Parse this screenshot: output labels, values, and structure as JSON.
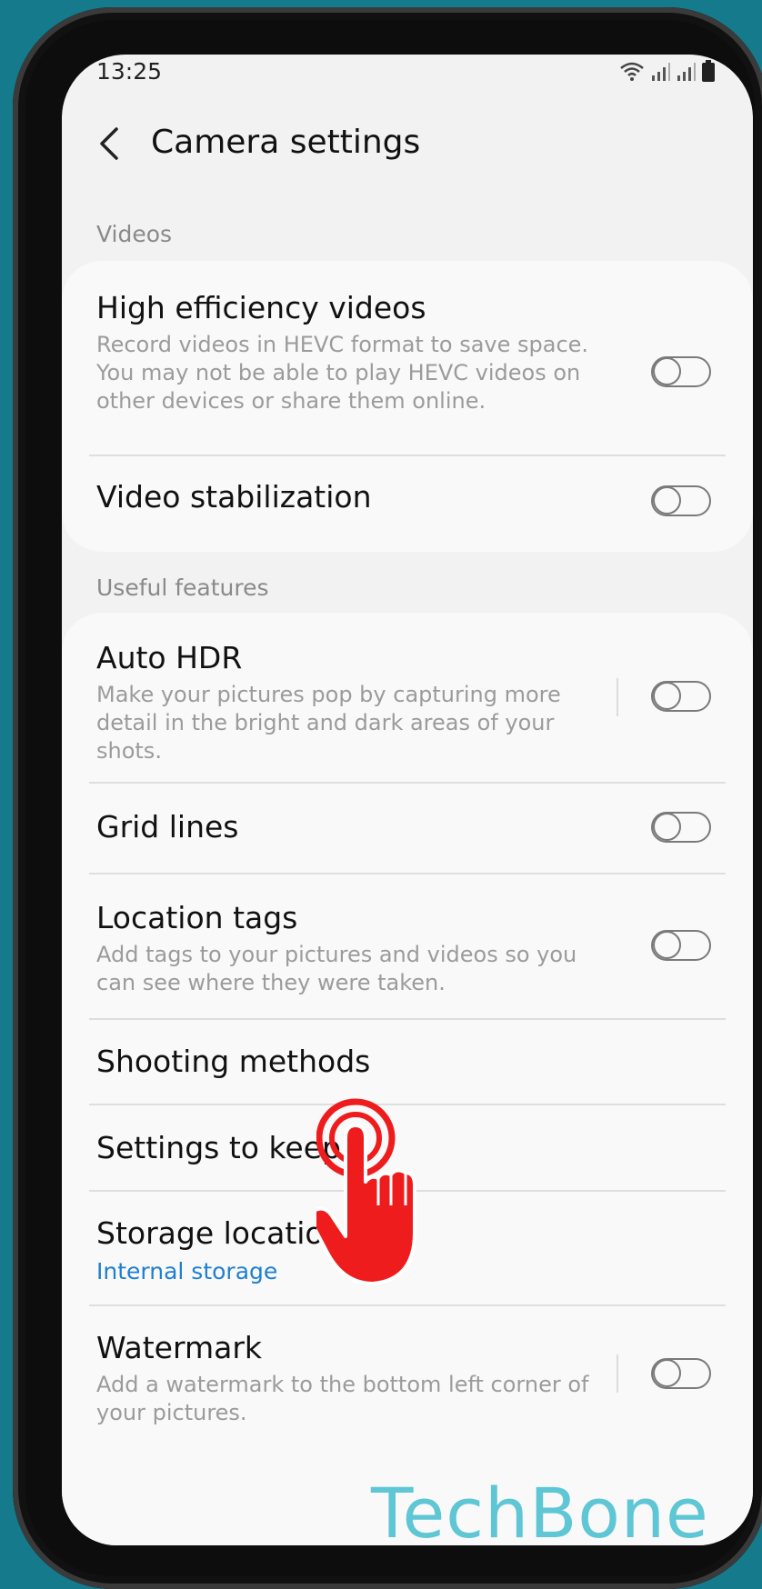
{
  "status": {
    "time": "13:25"
  },
  "header": {
    "title": "Camera settings"
  },
  "sections": {
    "videos": {
      "label": "Videos"
    },
    "useful": {
      "label": "Useful features"
    }
  },
  "settings": {
    "hev": {
      "title": "High efficiency videos",
      "desc": "Record videos in HEVC format to save space. You may not be able to play HEVC videos on other devices or share them online.",
      "enabled": false
    },
    "stab": {
      "title": "Video stabilization",
      "enabled": false
    },
    "hdr": {
      "title": "Auto HDR",
      "desc": "Make your pictures pop by capturing more detail in the bright and dark areas of your shots.",
      "enabled": false
    },
    "grid": {
      "title": "Grid lines",
      "enabled": false
    },
    "loc": {
      "title": "Location tags",
      "desc": "Add tags to your pictures and videos so you can see where they were taken.",
      "enabled": false
    },
    "shoot": {
      "title": "Shooting methods"
    },
    "keep": {
      "title": "Settings to keep"
    },
    "storage": {
      "title": "Storage location",
      "value": "Internal storage"
    },
    "wm": {
      "title": "Watermark",
      "desc": "Add a watermark to the bottom left corner of your pictures.",
      "enabled": false
    }
  },
  "overlay": {
    "brand": "TechBone"
  },
  "colors": {
    "accent": "#1f7fd0",
    "hand": "#ee1c1c",
    "background": "#157a8c"
  }
}
